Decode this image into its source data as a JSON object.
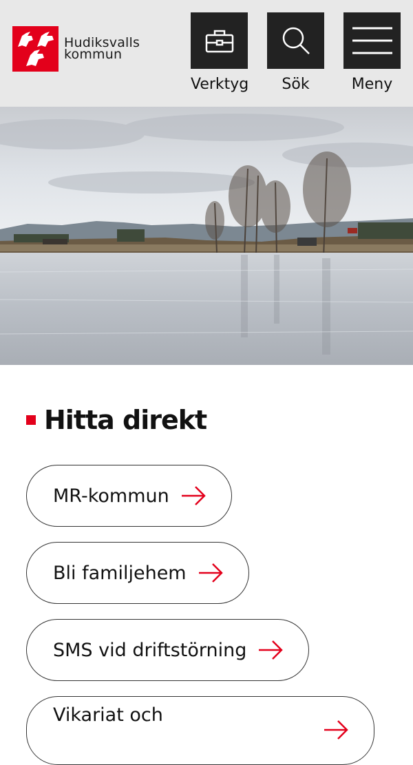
{
  "header": {
    "logo_line1": "Hudiksvalls",
    "logo_line2": "kommun",
    "tools": [
      {
        "label": "Verktyg",
        "icon": "toolbox-icon"
      },
      {
        "label": "Sök",
        "icon": "search-icon"
      },
      {
        "label": "Meny",
        "icon": "hamburger-menu-icon"
      }
    ]
  },
  "section": {
    "title": "Hitta direkt"
  },
  "quick_links": [
    {
      "label": "MR-kommun"
    },
    {
      "label": "Bli familjehem"
    },
    {
      "label": "SMS vid driftstörning"
    },
    {
      "label": "Vikariat och"
    }
  ],
  "colors": {
    "brand_red": "#e3001b",
    "header_bg": "#e8e8e8",
    "tool_bg": "#222222"
  }
}
